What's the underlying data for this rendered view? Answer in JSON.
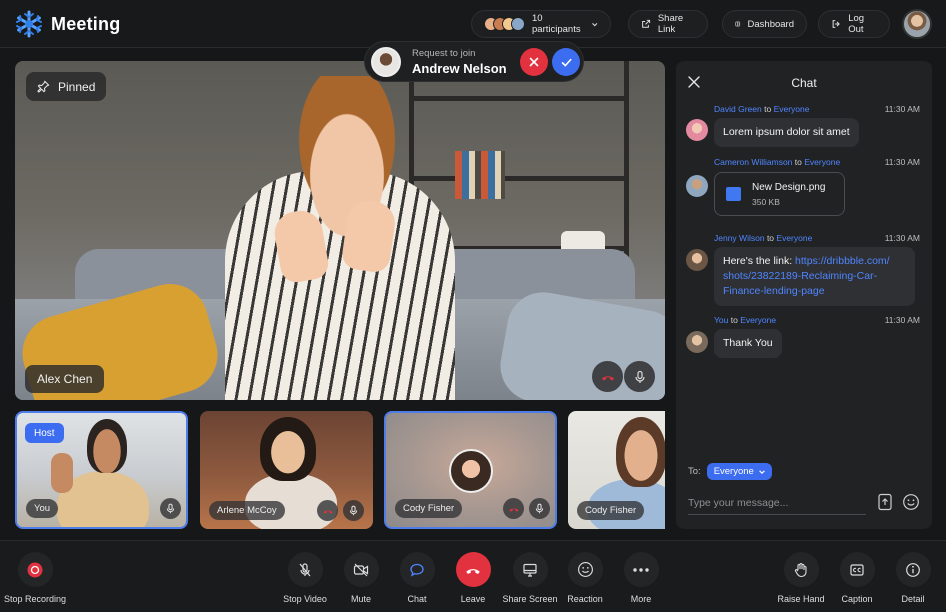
{
  "app": {
    "title": "Meeting",
    "logo_icon": "snowflake-logo-icon",
    "brand_color": "#4f86ff"
  },
  "header": {
    "participants_label": "10 participants",
    "share_link_label": "Share Link",
    "dashboard_label": "Dashboard",
    "logout_label": "Log Out"
  },
  "request": {
    "subtitle": "Request to join",
    "name": "Andrew Nelson"
  },
  "main_video": {
    "pinned_label": "Pinned",
    "speaker_name": "Alex Chen"
  },
  "thumbnails": [
    {
      "name": "You",
      "badge": "Host"
    },
    {
      "name": "Arlene McCoy"
    },
    {
      "name": "Cody Fisher"
    },
    {
      "name": "Cody Fisher"
    }
  ],
  "chat": {
    "title": "Chat",
    "messages": [
      {
        "sender": "David Green",
        "to_word": "to",
        "recipient": "Everyone",
        "time": "11:30 AM",
        "text": "Lorem ipsum dolor sit amet"
      },
      {
        "sender": "Cameron Williamson",
        "to_word": "to",
        "recipient": "Everyone",
        "time": "11:30 AM",
        "file_name": "New Design.png",
        "file_size": "350 KB"
      },
      {
        "sender": "Jenny Wilson",
        "to_word": "to",
        "recipient": "Everyone",
        "time": "11:30 AM",
        "text_prefix": "Here's the link: ",
        "link_line1": "https://dribbble.com/",
        "link_line2": "shots/23822189-Reclaiming-Car-",
        "link_line3": "Finance-lending-page"
      },
      {
        "sender": "You",
        "to_word": "to",
        "recipient": "Everyone",
        "time": "11:30 AM",
        "text": "Thank You"
      }
    ],
    "to_label": "To:",
    "to_value": "Everyone",
    "input_placeholder": "Type your message..."
  },
  "toolbar": {
    "stop_recording": "Stop Recording",
    "stop_video": "Stop Video",
    "mute": "Mute",
    "chat": "Chat",
    "leave": "Leave",
    "share_screen": "Share Screen",
    "reaction": "Reaction",
    "more": "More",
    "raise_hand": "Raise Hand",
    "caption": "Caption",
    "detail": "Detail"
  },
  "colors": {
    "accent": "#3c6df0",
    "danger": "#e3323f",
    "link": "#4f86ff",
    "background": "#161718"
  }
}
